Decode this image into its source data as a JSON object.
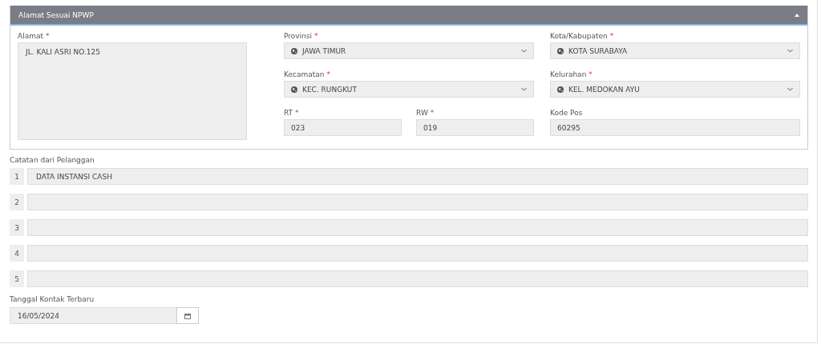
{
  "panel": {
    "title": "Alamat Sesuai NPWP",
    "expanded": true,
    "address": {
      "label": "Alamat",
      "required_mark": "*",
      "value": "JL. KALI ASRI NO.125"
    },
    "selects": [
      {
        "label": "Provinsi",
        "required_mark": "*",
        "value": "JAWA TIMUR"
      },
      {
        "label": "Kota/Kabupaten",
        "required_mark": "*",
        "value": "KOTA SURABAYA"
      },
      {
        "label": "Kecamatan",
        "required_mark": "*",
        "value": "KEC. RUNGKUT"
      },
      {
        "label": "Kelurahan",
        "required_mark": "*",
        "value": "KEL. MEDOKAN AYU"
      }
    ],
    "inputs": [
      {
        "label": "RT",
        "required_mark": "*",
        "value": "023"
      },
      {
        "label": "RW",
        "required_mark": "*",
        "value": "019"
      },
      {
        "label": "Kode Pos",
        "value": "60295"
      }
    ]
  },
  "notes": {
    "label": "Catatan dari Pelanggan",
    "rows": [
      {
        "number": "1",
        "value": "DATA INSTANSI CASH"
      },
      {
        "number": "2"
      },
      {
        "number": "3"
      },
      {
        "number": "4"
      },
      {
        "number": "5"
      }
    ]
  },
  "last_contact": {
    "label": "Tanggal Kontak Terbaru",
    "value": "16/05/2024"
  }
}
